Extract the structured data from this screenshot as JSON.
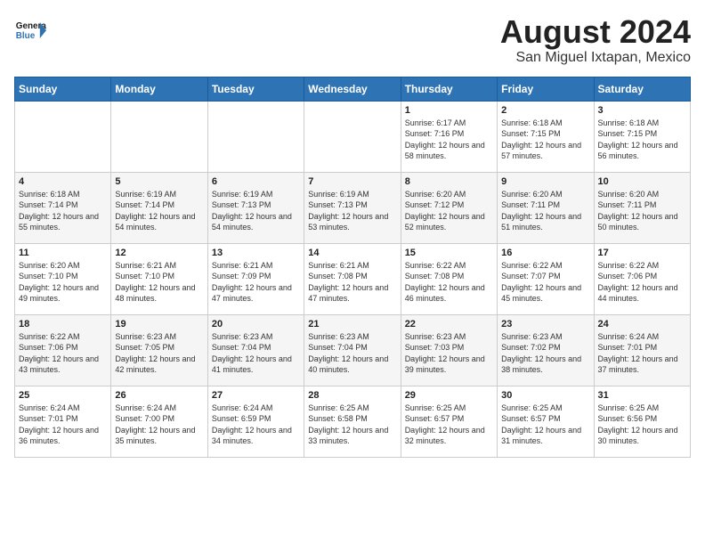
{
  "header": {
    "logo_text_general": "General",
    "logo_text_blue": "Blue",
    "month_year": "August 2024",
    "location": "San Miguel Ixtapan, Mexico"
  },
  "calendar": {
    "days_of_week": [
      "Sunday",
      "Monday",
      "Tuesday",
      "Wednesday",
      "Thursday",
      "Friday",
      "Saturday"
    ],
    "weeks": [
      [
        {
          "day": "",
          "sunrise": "",
          "sunset": "",
          "daylight": ""
        },
        {
          "day": "",
          "sunrise": "",
          "sunset": "",
          "daylight": ""
        },
        {
          "day": "",
          "sunrise": "",
          "sunset": "",
          "daylight": ""
        },
        {
          "day": "",
          "sunrise": "",
          "sunset": "",
          "daylight": ""
        },
        {
          "day": "1",
          "sunrise": "Sunrise: 6:17 AM",
          "sunset": "Sunset: 7:16 PM",
          "daylight": "Daylight: 12 hours and 58 minutes."
        },
        {
          "day": "2",
          "sunrise": "Sunrise: 6:18 AM",
          "sunset": "Sunset: 7:15 PM",
          "daylight": "Daylight: 12 hours and 57 minutes."
        },
        {
          "day": "3",
          "sunrise": "Sunrise: 6:18 AM",
          "sunset": "Sunset: 7:15 PM",
          "daylight": "Daylight: 12 hours and 56 minutes."
        }
      ],
      [
        {
          "day": "4",
          "sunrise": "Sunrise: 6:18 AM",
          "sunset": "Sunset: 7:14 PM",
          "daylight": "Daylight: 12 hours and 55 minutes."
        },
        {
          "day": "5",
          "sunrise": "Sunrise: 6:19 AM",
          "sunset": "Sunset: 7:14 PM",
          "daylight": "Daylight: 12 hours and 54 minutes."
        },
        {
          "day": "6",
          "sunrise": "Sunrise: 6:19 AM",
          "sunset": "Sunset: 7:13 PM",
          "daylight": "Daylight: 12 hours and 54 minutes."
        },
        {
          "day": "7",
          "sunrise": "Sunrise: 6:19 AM",
          "sunset": "Sunset: 7:13 PM",
          "daylight": "Daylight: 12 hours and 53 minutes."
        },
        {
          "day": "8",
          "sunrise": "Sunrise: 6:20 AM",
          "sunset": "Sunset: 7:12 PM",
          "daylight": "Daylight: 12 hours and 52 minutes."
        },
        {
          "day": "9",
          "sunrise": "Sunrise: 6:20 AM",
          "sunset": "Sunset: 7:11 PM",
          "daylight": "Daylight: 12 hours and 51 minutes."
        },
        {
          "day": "10",
          "sunrise": "Sunrise: 6:20 AM",
          "sunset": "Sunset: 7:11 PM",
          "daylight": "Daylight: 12 hours and 50 minutes."
        }
      ],
      [
        {
          "day": "11",
          "sunrise": "Sunrise: 6:20 AM",
          "sunset": "Sunset: 7:10 PM",
          "daylight": "Daylight: 12 hours and 49 minutes."
        },
        {
          "day": "12",
          "sunrise": "Sunrise: 6:21 AM",
          "sunset": "Sunset: 7:10 PM",
          "daylight": "Daylight: 12 hours and 48 minutes."
        },
        {
          "day": "13",
          "sunrise": "Sunrise: 6:21 AM",
          "sunset": "Sunset: 7:09 PM",
          "daylight": "Daylight: 12 hours and 47 minutes."
        },
        {
          "day": "14",
          "sunrise": "Sunrise: 6:21 AM",
          "sunset": "Sunset: 7:08 PM",
          "daylight": "Daylight: 12 hours and 47 minutes."
        },
        {
          "day": "15",
          "sunrise": "Sunrise: 6:22 AM",
          "sunset": "Sunset: 7:08 PM",
          "daylight": "Daylight: 12 hours and 46 minutes."
        },
        {
          "day": "16",
          "sunrise": "Sunrise: 6:22 AM",
          "sunset": "Sunset: 7:07 PM",
          "daylight": "Daylight: 12 hours and 45 minutes."
        },
        {
          "day": "17",
          "sunrise": "Sunrise: 6:22 AM",
          "sunset": "Sunset: 7:06 PM",
          "daylight": "Daylight: 12 hours and 44 minutes."
        }
      ],
      [
        {
          "day": "18",
          "sunrise": "Sunrise: 6:22 AM",
          "sunset": "Sunset: 7:06 PM",
          "daylight": "Daylight: 12 hours and 43 minutes."
        },
        {
          "day": "19",
          "sunrise": "Sunrise: 6:23 AM",
          "sunset": "Sunset: 7:05 PM",
          "daylight": "Daylight: 12 hours and 42 minutes."
        },
        {
          "day": "20",
          "sunrise": "Sunrise: 6:23 AM",
          "sunset": "Sunset: 7:04 PM",
          "daylight": "Daylight: 12 hours and 41 minutes."
        },
        {
          "day": "21",
          "sunrise": "Sunrise: 6:23 AM",
          "sunset": "Sunset: 7:04 PM",
          "daylight": "Daylight: 12 hours and 40 minutes."
        },
        {
          "day": "22",
          "sunrise": "Sunrise: 6:23 AM",
          "sunset": "Sunset: 7:03 PM",
          "daylight": "Daylight: 12 hours and 39 minutes."
        },
        {
          "day": "23",
          "sunrise": "Sunrise: 6:23 AM",
          "sunset": "Sunset: 7:02 PM",
          "daylight": "Daylight: 12 hours and 38 minutes."
        },
        {
          "day": "24",
          "sunrise": "Sunrise: 6:24 AM",
          "sunset": "Sunset: 7:01 PM",
          "daylight": "Daylight: 12 hours and 37 minutes."
        }
      ],
      [
        {
          "day": "25",
          "sunrise": "Sunrise: 6:24 AM",
          "sunset": "Sunset: 7:01 PM",
          "daylight": "Daylight: 12 hours and 36 minutes."
        },
        {
          "day": "26",
          "sunrise": "Sunrise: 6:24 AM",
          "sunset": "Sunset: 7:00 PM",
          "daylight": "Daylight: 12 hours and 35 minutes."
        },
        {
          "day": "27",
          "sunrise": "Sunrise: 6:24 AM",
          "sunset": "Sunset: 6:59 PM",
          "daylight": "Daylight: 12 hours and 34 minutes."
        },
        {
          "day": "28",
          "sunrise": "Sunrise: 6:25 AM",
          "sunset": "Sunset: 6:58 PM",
          "daylight": "Daylight: 12 hours and 33 minutes."
        },
        {
          "day": "29",
          "sunrise": "Sunrise: 6:25 AM",
          "sunset": "Sunset: 6:57 PM",
          "daylight": "Daylight: 12 hours and 32 minutes."
        },
        {
          "day": "30",
          "sunrise": "Sunrise: 6:25 AM",
          "sunset": "Sunset: 6:57 PM",
          "daylight": "Daylight: 12 hours and 31 minutes."
        },
        {
          "day": "31",
          "sunrise": "Sunrise: 6:25 AM",
          "sunset": "Sunset: 6:56 PM",
          "daylight": "Daylight: 12 hours and 30 minutes."
        }
      ]
    ]
  }
}
